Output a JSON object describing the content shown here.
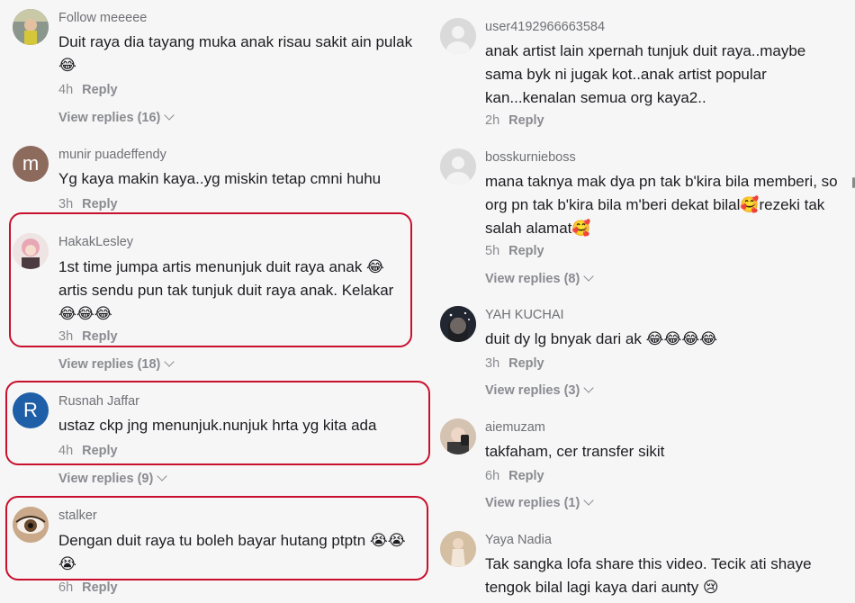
{
  "left_comments": [
    {
      "user": "Follow meeeee",
      "text": "Duit raya dia tayang muka anak risau sakit ain pulak😂",
      "time": "4h",
      "reply": "Reply",
      "view_replies": "View replies (16)"
    },
    {
      "user": "munir puadeffendy",
      "text": "Yg kaya makin kaya..yg miskin tetap cmni huhu",
      "time": "3h",
      "reply": "Reply",
      "avatar_letter": "m"
    },
    {
      "user": "HakakLesley",
      "text": "1st time jumpa artis menunjuk duit raya anak 😂 artis sendu pun tak tunjuk duit raya anak. Kelakar 😂😂😂",
      "time": "3h",
      "reply": "Reply",
      "view_replies": "View replies (18)"
    },
    {
      "user": "Rusnah Jaffar",
      "text": "ustaz ckp jng menunjuk.nunjuk hrta yg kita ada",
      "time": "4h",
      "reply": "Reply",
      "view_replies": "View replies (9)",
      "avatar_letter": "R"
    },
    {
      "user": "stalker",
      "text": "Dengan duit raya tu boleh bayar hutang ptptn 😭😭😭",
      "time": "6h",
      "reply": "Reply"
    }
  ],
  "right_comments": [
    {
      "user": "user4192966663584",
      "text": "anak artist lain xpernah tunjuk duit raya..maybe sama byk ni jugak kot..anak artist popular kan...kenalan semua org kaya2..",
      "time": "2h",
      "reply": "Reply"
    },
    {
      "user": "bosskurnieboss",
      "text": "mana taknya mak dya pn tak b'kira bila memberi, so org pn tak b'kira bila m'beri dekat bilal🥰rezeki tak salah alamat🥰",
      "time": "5h",
      "reply": "Reply",
      "view_replies": "View replies (8)"
    },
    {
      "user": "YAH KUCHAI",
      "text": "duit dy lg bnyak dari ak 😂😂😂😂",
      "time": "3h",
      "reply": "Reply",
      "view_replies": "View replies (3)"
    },
    {
      "user": "aiemuzam",
      "text": "takfaham, cer transfer sikit",
      "time": "6h",
      "reply": "Reply",
      "view_replies": "View replies (1)"
    },
    {
      "user": "Yaya Nadia",
      "text": "Tak sangka lofa share this video. Tecik ati shaye tengok bilal lagi kaya dari aunty 😢"
    }
  ],
  "colors": {
    "highlight": "#c8102e",
    "rusnah_avatar": "#1f5fa8",
    "munir_avatar": "#8c6a5c"
  }
}
